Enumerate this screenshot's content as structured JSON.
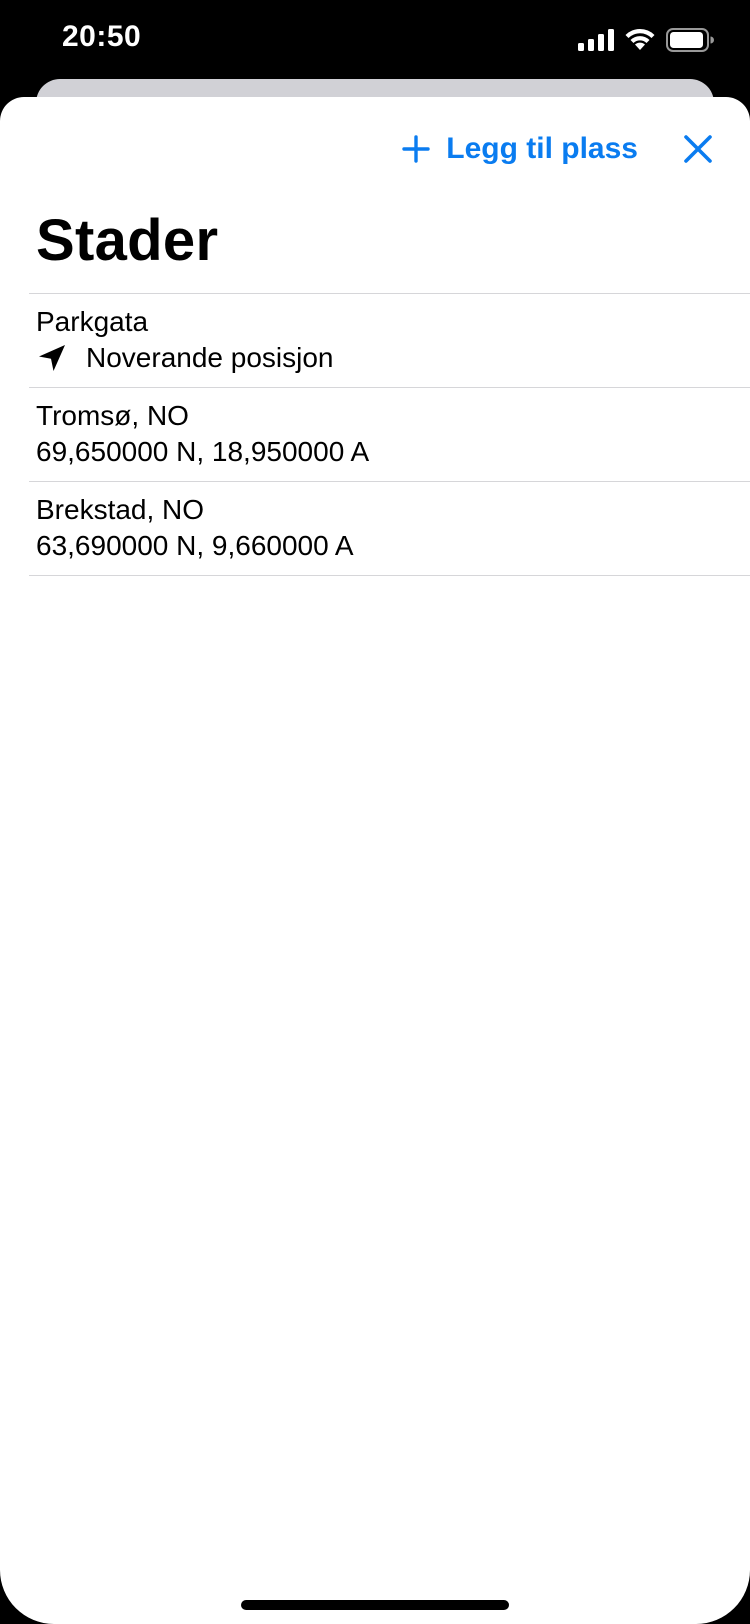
{
  "status_bar": {
    "time": "20:50",
    "icons": [
      "cellular-signal-icon",
      "wifi-icon",
      "battery-icon"
    ]
  },
  "nav": {
    "add_place_label": "Legg til plass",
    "add_icon": "plus-icon",
    "close_icon": "close-icon"
  },
  "page": {
    "title": "Stader"
  },
  "places": [
    {
      "title": "Parkgata",
      "subtitle": "Noverande posisjon",
      "icon": "location-arrow-icon"
    },
    {
      "title": "Tromsø, NO",
      "subtitle": "69,650000 N, 18,950000 A"
    },
    {
      "title": "Brekstad, NO",
      "subtitle": "63,690000 N, 9,660000 A"
    }
  ],
  "colors": {
    "accent": "#0a7cf0",
    "background": "#ffffff",
    "separator": "#d6d6d9"
  }
}
